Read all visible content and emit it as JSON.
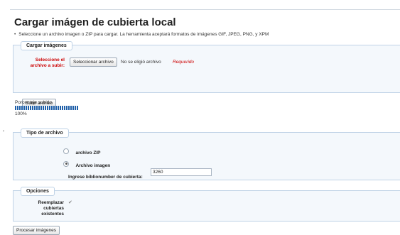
{
  "page": {
    "title": "Cargar imágen de cubierta local",
    "intro": "Seleccione un archivo imagen o ZIP para cargar. La herramienta aceptará formatos de imágenes GIF, JPEG, PNG, y XPM",
    "bullet": "•"
  },
  "upload": {
    "legend": "Cargar imágenes",
    "file_label": "Seleccione el archivo a subir:",
    "choose_button": "Seleccionar archivo",
    "no_file_text": "No se eligió archivo",
    "required_text": "Requerido",
    "submit_button": "Subir archivo"
  },
  "progress": {
    "label": "Porcentaje subido",
    "percent_text": "100%",
    "fraction": 1.0
  },
  "file_type": {
    "legend": "Tipo de archivo",
    "options": [
      {
        "label": "archivo ZIP",
        "selected": false
      },
      {
        "label": "Archivo imagen",
        "selected": true
      }
    ],
    "biblionumber_label": "Ingrese biblionumber de cubierta:",
    "biblionumber_value": "3260"
  },
  "options": {
    "legend": "Opciones",
    "replace_label": "Reemplazar cubiertas existentes",
    "replace_checked": true
  },
  "actions": {
    "process_button": "Procesar imágenes"
  },
  "colors": {
    "accent": "#1f5fa8",
    "required": "#cc0000",
    "box_border": "#bfd2e6",
    "box_bg": "#f4f8fc"
  }
}
